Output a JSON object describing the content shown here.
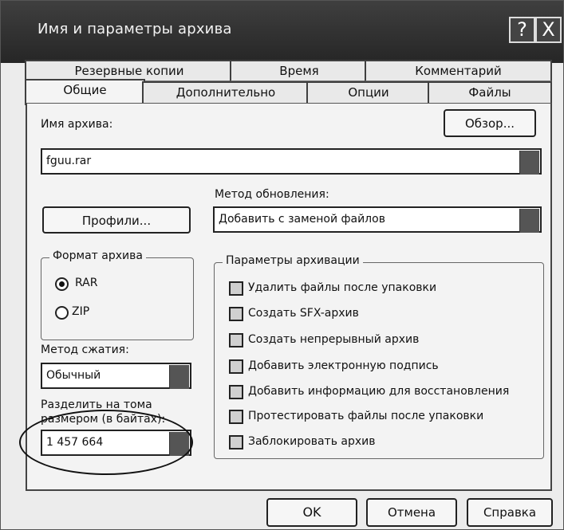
{
  "window": {
    "title": "Имя и параметры архива"
  },
  "title_buttons": {
    "help": "?",
    "close": "X"
  },
  "tabs": {
    "back": [
      "Резервные копии",
      "Время",
      "Комментарий"
    ],
    "front": [
      "Общие",
      "Дополнительно",
      "Опции",
      "Файлы"
    ],
    "active": "Общие"
  },
  "archive_name": {
    "label": "Имя архива:",
    "value": "fguu.rar"
  },
  "browse_label": "Обзор...",
  "profiles_label": "Профили...",
  "update_method": {
    "label": "Метод обновления:",
    "value": "Добавить с заменой файлов"
  },
  "format": {
    "group_title": "Формат архива",
    "options": [
      "RAR",
      "ZIP"
    ],
    "selected": "RAR"
  },
  "compression": {
    "label": "Метод сжатия:",
    "value": "Обычный"
  },
  "split": {
    "label_line1": "Разделить на тома",
    "label_line2": "размером (в байтах):",
    "value": "1 457 664"
  },
  "archiving_params": {
    "group_title": "Параметры архивации",
    "options": [
      "Удалить файлы после упаковки",
      "Создать SFX-архив",
      "Создать непрерывный архив",
      "Добавить электронную подпись",
      "Добавить информацию для восстановления",
      "Протестировать файлы после упаковки",
      "Заблокировать архив"
    ]
  },
  "buttons": {
    "ok": "OK",
    "cancel": "Отмена",
    "help": "Справка"
  }
}
